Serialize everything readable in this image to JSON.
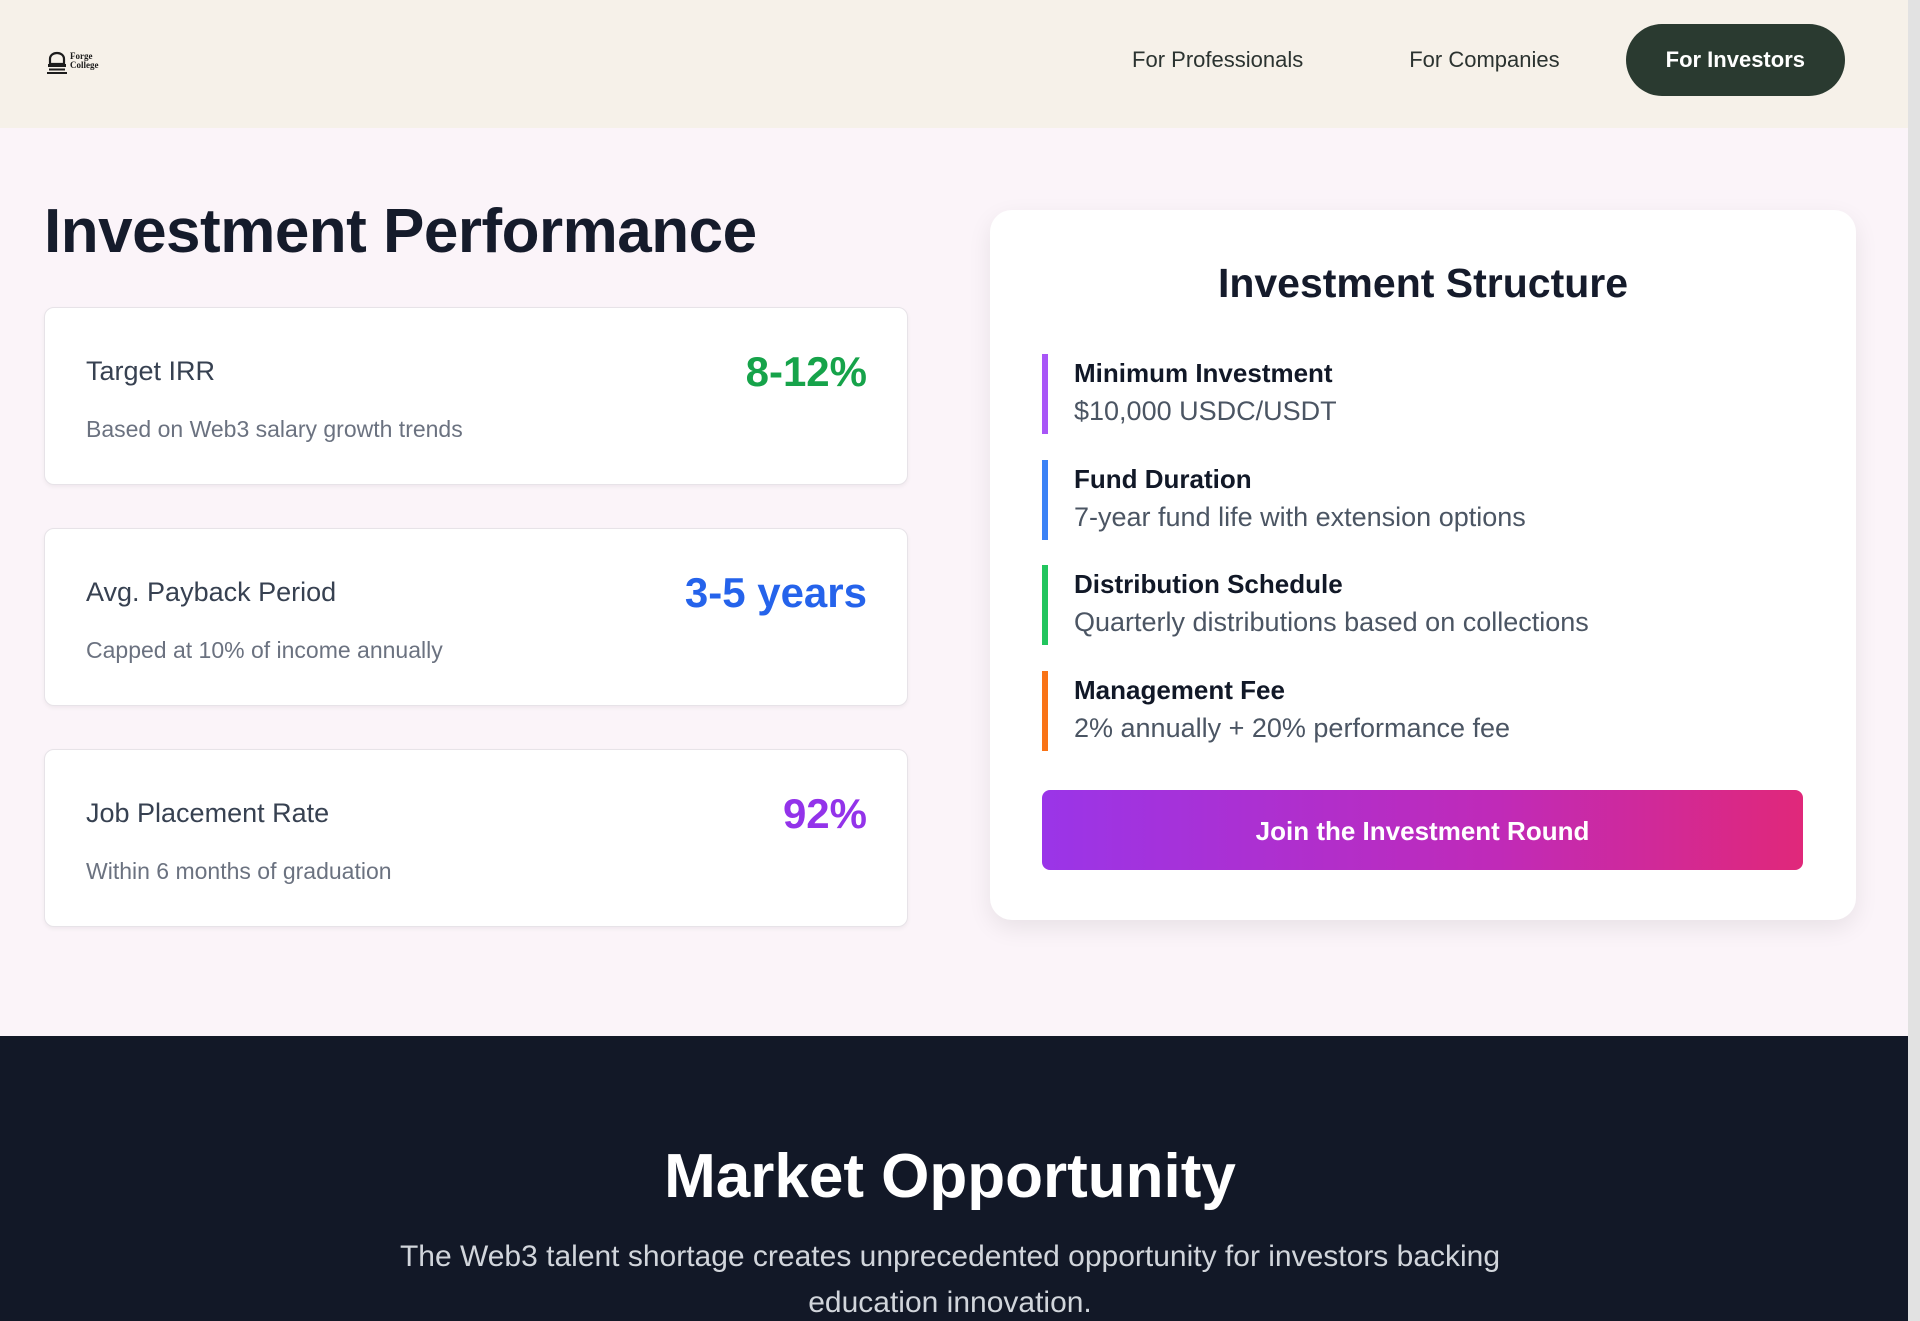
{
  "header": {
    "logo": {
      "line1": "Forge",
      "line2": "College"
    },
    "nav": [
      {
        "label": "For Professionals"
      },
      {
        "label": "For Companies"
      },
      {
        "label": "For Investors",
        "active": true
      }
    ]
  },
  "performance": {
    "title": "Investment Performance",
    "stats": [
      {
        "label": "Target IRR",
        "value": "8-12%",
        "note": "Based on Web3 salary growth trends",
        "color": "#16a34a"
      },
      {
        "label": "Avg. Payback Period",
        "value": "3-5 years",
        "note": "Capped at 10% of income annually",
        "color": "#2563eb"
      },
      {
        "label": "Job Placement Rate",
        "value": "92%",
        "note": "Within 6 months of graduation",
        "color": "#9333ea"
      }
    ]
  },
  "structure": {
    "title": "Investment Structure",
    "items": [
      {
        "title": "Minimum Investment",
        "desc": "$10,000 USDC/USDT",
        "accent": "#a855f7"
      },
      {
        "title": "Fund Duration",
        "desc": "7-year fund life with extension options",
        "accent": "#3b82f6"
      },
      {
        "title": "Distribution Schedule",
        "desc": "Quarterly distributions based on collections",
        "accent": "#22c55e"
      },
      {
        "title": "Management Fee",
        "desc": "2% annually + 20% performance fee",
        "accent": "#f97316"
      }
    ],
    "cta_label": "Join the Investment Round"
  },
  "market": {
    "title": "Market Opportunity",
    "text": "The Web3 talent shortage creates unprecedented opportunity for investors backing education innovation."
  }
}
